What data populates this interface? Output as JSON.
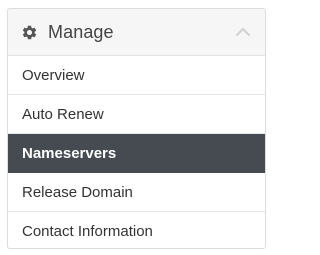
{
  "panel": {
    "title": "Manage",
    "header_icon": "gear-icon",
    "collapse_icon": "chevron-up-icon"
  },
  "menu": {
    "items": [
      {
        "label": "Overview",
        "active": false
      },
      {
        "label": "Auto Renew",
        "active": false
      },
      {
        "label": "Nameservers",
        "active": true
      },
      {
        "label": "Release Domain",
        "active": false
      },
      {
        "label": "Contact Information",
        "active": false
      }
    ]
  },
  "colors": {
    "active_bg": "#454b51",
    "active_text": "#ffffff",
    "header_bg": "#f6f6f6",
    "text": "#333333"
  }
}
